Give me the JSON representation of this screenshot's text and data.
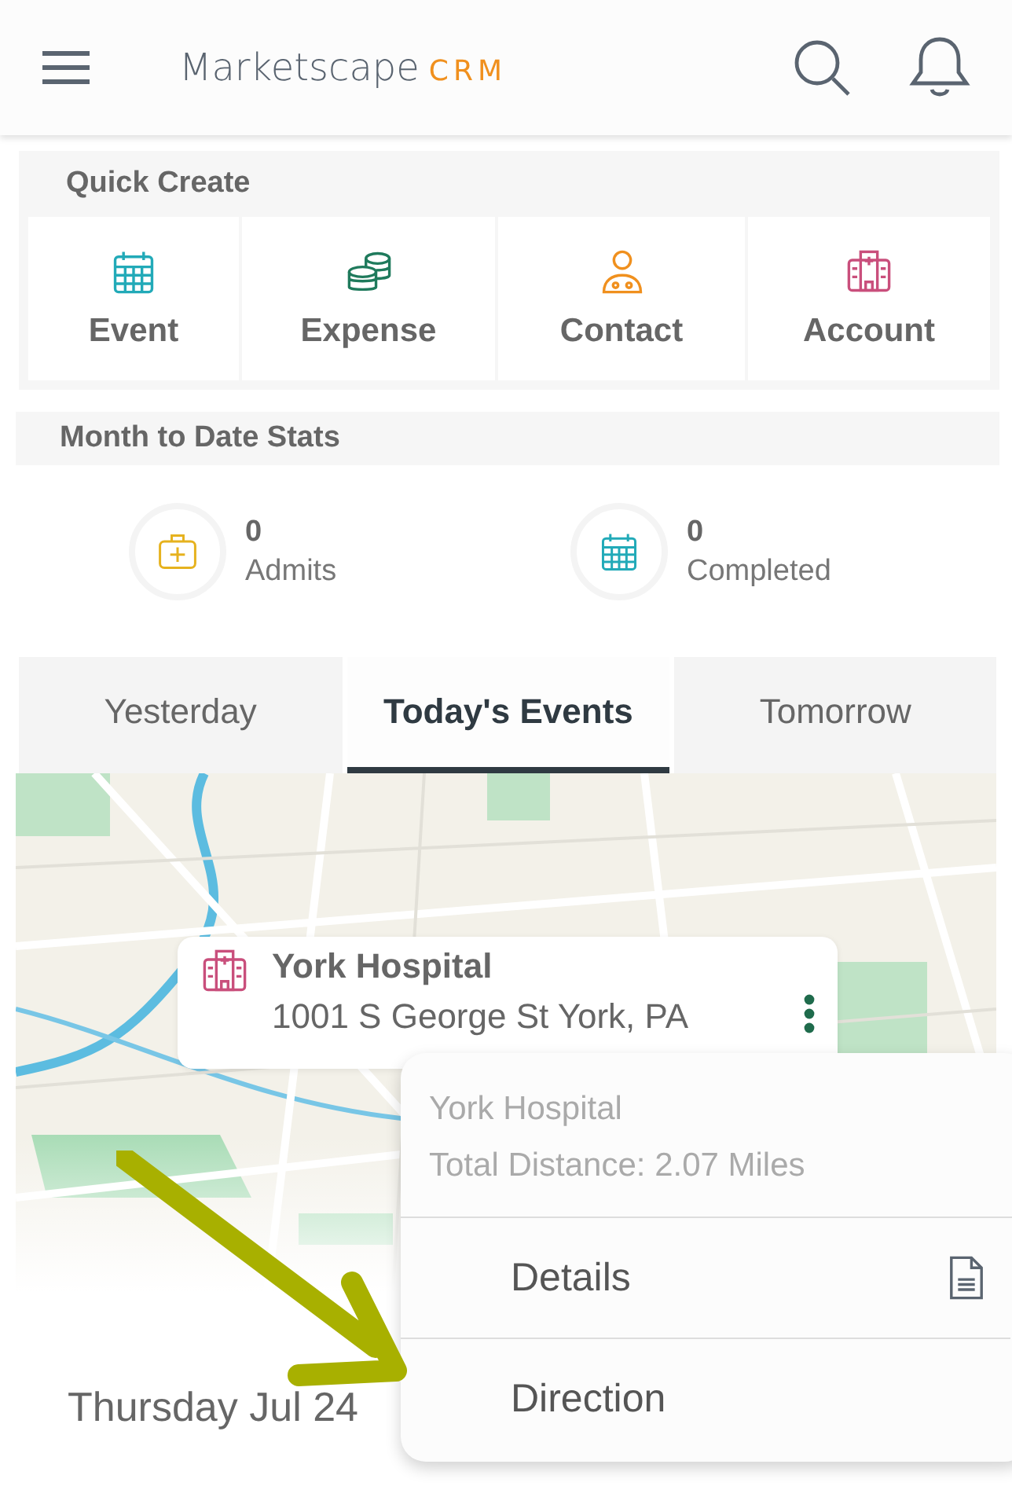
{
  "header": {
    "brand": "Marketscape",
    "brand_suffix": "CRM"
  },
  "quick_create": {
    "title": "Quick Create",
    "items": [
      {
        "label": "Event",
        "kind": "calendar",
        "color": "#22aab8"
      },
      {
        "label": "Expense",
        "kind": "coins",
        "color": "#1f7a5c"
      },
      {
        "label": "Contact",
        "kind": "person",
        "color": "#f0901e"
      },
      {
        "label": "Account",
        "kind": "hospital",
        "color": "#c94f7c"
      }
    ]
  },
  "stats": {
    "title": "Month to Date Stats",
    "items": [
      {
        "value": "0",
        "label": "Admits",
        "kind": "medkit",
        "color": "#e6b21e"
      },
      {
        "value": "0",
        "label": "Completed",
        "kind": "calendar",
        "color": "#22aab8"
      }
    ]
  },
  "tabs": [
    {
      "label": "Yesterday",
      "selected": false
    },
    {
      "label": "Today's Events",
      "selected": true
    },
    {
      "label": "Tomorrow",
      "selected": false
    }
  ],
  "map": {
    "kind": "picture",
    "place": {
      "name": "York Hospital",
      "address": "1001 S George St York, PA"
    }
  },
  "popup": {
    "title": "York Hospital",
    "subtitle": "Total Distance: 2.07 Miles",
    "items": [
      {
        "label": "Details",
        "kind": "document"
      },
      {
        "label": "Direction",
        "kind": "plain"
      }
    ]
  },
  "date": "Thursday Jul 24"
}
